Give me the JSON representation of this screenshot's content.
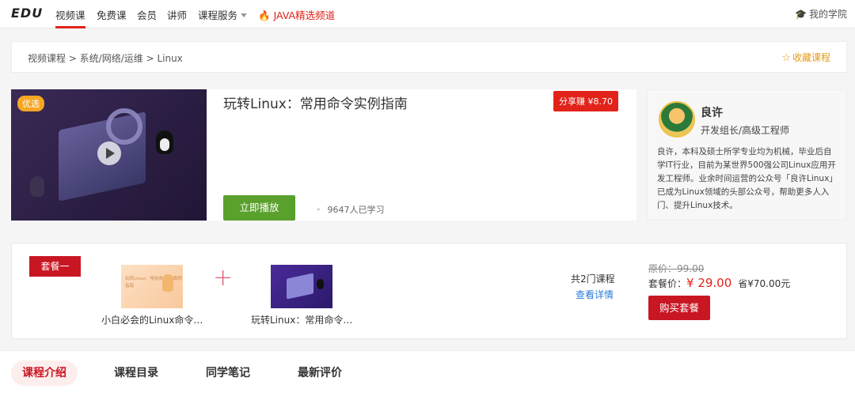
{
  "nav": {
    "logo": "EDU",
    "items": [
      "视频课",
      "免费课",
      "会员",
      "讲师",
      "课程服务"
    ],
    "java": "JAVA精选频道",
    "my_school": "我的学院"
  },
  "breadcrumb": {
    "path": "视频课程 > 系统/网络/运维 > Linux",
    "favorite": "收藏课程"
  },
  "course": {
    "badge": "优选",
    "title": "玩转Linux：常用命令实例指南",
    "share": "分享赚 ¥8.70",
    "play": "立即播放",
    "learners": "9647人已学习"
  },
  "teacher": {
    "name": "良许",
    "role": "开发组长/高级工程师",
    "bio": "良许，本科及硕士所学专业均为机械，毕业后自学IT行业，目前为某世界500强公司Linux应用开发工程师。业余时间运营的公众号「良许Linux」已成为Linux领域的头部公众号，帮助更多人入门、提升Linux技术。"
  },
  "package": {
    "tag": "套餐一",
    "thumb1_text": "玩转Linux：常用命令 全面例指南",
    "course1": "小白必会的Linux命令…",
    "course2": "玩转Linux：常用命令…",
    "count": "共2门课程",
    "detail": "查看详情",
    "original": "原价：99.00",
    "price_label": "套餐价：",
    "price": "¥ 29.00",
    "save": "省¥70.00元",
    "buy": "购买套餐"
  },
  "tabs": [
    "课程介绍",
    "课程目录",
    "同学笔记",
    "最新评价"
  ],
  "colors": {
    "brand_red": "#c81623",
    "accent_red": "#e2231a",
    "play_green": "#5aa02c",
    "fav_orange": "#e69b12",
    "link_blue": "#2a7ad8"
  },
  "icons": {
    "my_school": "graduation-cap-icon",
    "favorite": "star-outline-icon",
    "java": "fire-icon",
    "cover": "play-icon"
  }
}
